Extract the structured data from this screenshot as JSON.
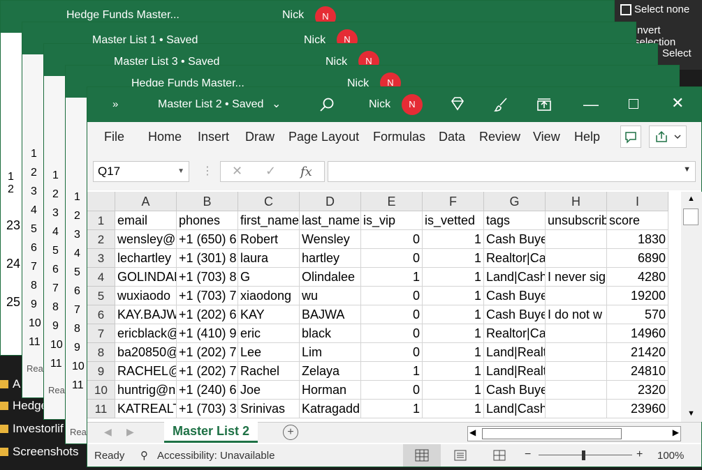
{
  "side_menu": {
    "items": [
      "Select none",
      "Invert selection",
      "Select"
    ]
  },
  "explorer": {
    "items": [
      "A",
      "Hedge",
      "Investorlif",
      "Screenshots"
    ]
  },
  "bg_windows": [
    {
      "title": "Hedge Funds Master...",
      "user": "Nick",
      "avatar": "N",
      "rows": [
        "1",
        "2",
        "23",
        "24",
        "25"
      ]
    },
    {
      "title": "Master List 1 • Saved",
      "user": "Nick",
      "avatar": "N",
      "rows": [
        "1",
        "2",
        "3",
        "4",
        "5",
        "6",
        "7",
        "8",
        "9",
        "10",
        "11"
      ],
      "status": "Rea"
    },
    {
      "title": "Master List 3 • Saved",
      "user": "Nick",
      "avatar": "N",
      "rows": [
        "1",
        "2",
        "3",
        "4",
        "5",
        "6",
        "7",
        "8",
        "9",
        "10",
        "11"
      ],
      "status": "Rea"
    },
    {
      "title": "Hedge Funds Master...",
      "user": "Nick",
      "avatar": "N",
      "rows": [
        "1",
        "2",
        "3",
        "4",
        "5",
        "6",
        "7",
        "8",
        "9",
        "10",
        "11"
      ],
      "status": "Rea"
    }
  ],
  "main": {
    "title": "Master List 2 • Saved",
    "user": "Nick",
    "avatar": "N",
    "menu": [
      "File",
      "Home",
      "Insert",
      "Draw",
      "Page Layout",
      "Formulas",
      "Data",
      "Review",
      "View",
      "Help"
    ],
    "name_box": "Q17",
    "fx": "fx",
    "columns": [
      "A",
      "B",
      "C",
      "D",
      "E",
      "F",
      "G",
      "H",
      "I"
    ],
    "rows": [
      {
        "n": "1",
        "c": [
          "email",
          "phones",
          "first_name",
          "last_name",
          "is_vip",
          "is_vetted",
          "tags",
          "unsubscrib",
          "score"
        ]
      },
      {
        "n": "2",
        "c": [
          "wensley@",
          "+1 (650) 6",
          "Robert",
          "Wensley",
          "0",
          "1",
          "Cash Buyer|Fix and F",
          "",
          "1830"
        ]
      },
      {
        "n": "3",
        "c": [
          "lechartley",
          "+1 (301) 8",
          "laura",
          "hartley",
          "0",
          "1",
          "Realtor|Cash Buyer",
          "",
          "6890"
        ]
      },
      {
        "n": "4",
        "c": [
          "GOLINDAL",
          "+1 (703) 8",
          "G",
          "Olindalee",
          "1",
          "1",
          "Land|Cash",
          "I never sig",
          "4280"
        ]
      },
      {
        "n": "5",
        "c": [
          "wuxiaodo",
          "+1 (703) 7",
          "xiaodong",
          "wu",
          "0",
          "1",
          "Cash Buyer",
          "",
          "19200"
        ]
      },
      {
        "n": "6",
        "c": [
          "KAY.BAJW",
          "+1 (202) 6",
          "KAY",
          "BAJWA",
          "0",
          "1",
          "Cash Buye",
          "I do not w",
          "570"
        ]
      },
      {
        "n": "7",
        "c": [
          "ericblack@",
          "+1 (410) 9",
          "eric",
          "black",
          "0",
          "1",
          "Realtor|Cash Buyer",
          "",
          "14960"
        ]
      },
      {
        "n": "8",
        "c": [
          "ba20850@",
          "+1 (202) 7",
          "Lee",
          "Lim",
          "0",
          "1",
          "Land|Realtor|Cash B",
          "",
          "21420"
        ]
      },
      {
        "n": "9",
        "c": [
          "RACHEL@",
          "+1 (202) 7",
          "Rachel",
          "Zelaya",
          "1",
          "1",
          "Land|Realtor|Cash B",
          "",
          "24810"
        ]
      },
      {
        "n": "10",
        "c": [
          "huntrig@n",
          "+1 (240) 6",
          "Joe",
          "Horman",
          "0",
          "1",
          "Cash Buyer",
          "",
          "2320"
        ]
      },
      {
        "n": "11",
        "c": [
          "KATREALT",
          "+1 (703) 3",
          "Srinivas",
          "Katragadd",
          "1",
          "1",
          "Land|Cash Buyer|Fix",
          "",
          "23960"
        ]
      }
    ],
    "sheet_tab": "Master List 2",
    "status": {
      "ready": "Ready",
      "accessibility": "Accessibility: Unavailable",
      "zoom": "100%"
    }
  }
}
